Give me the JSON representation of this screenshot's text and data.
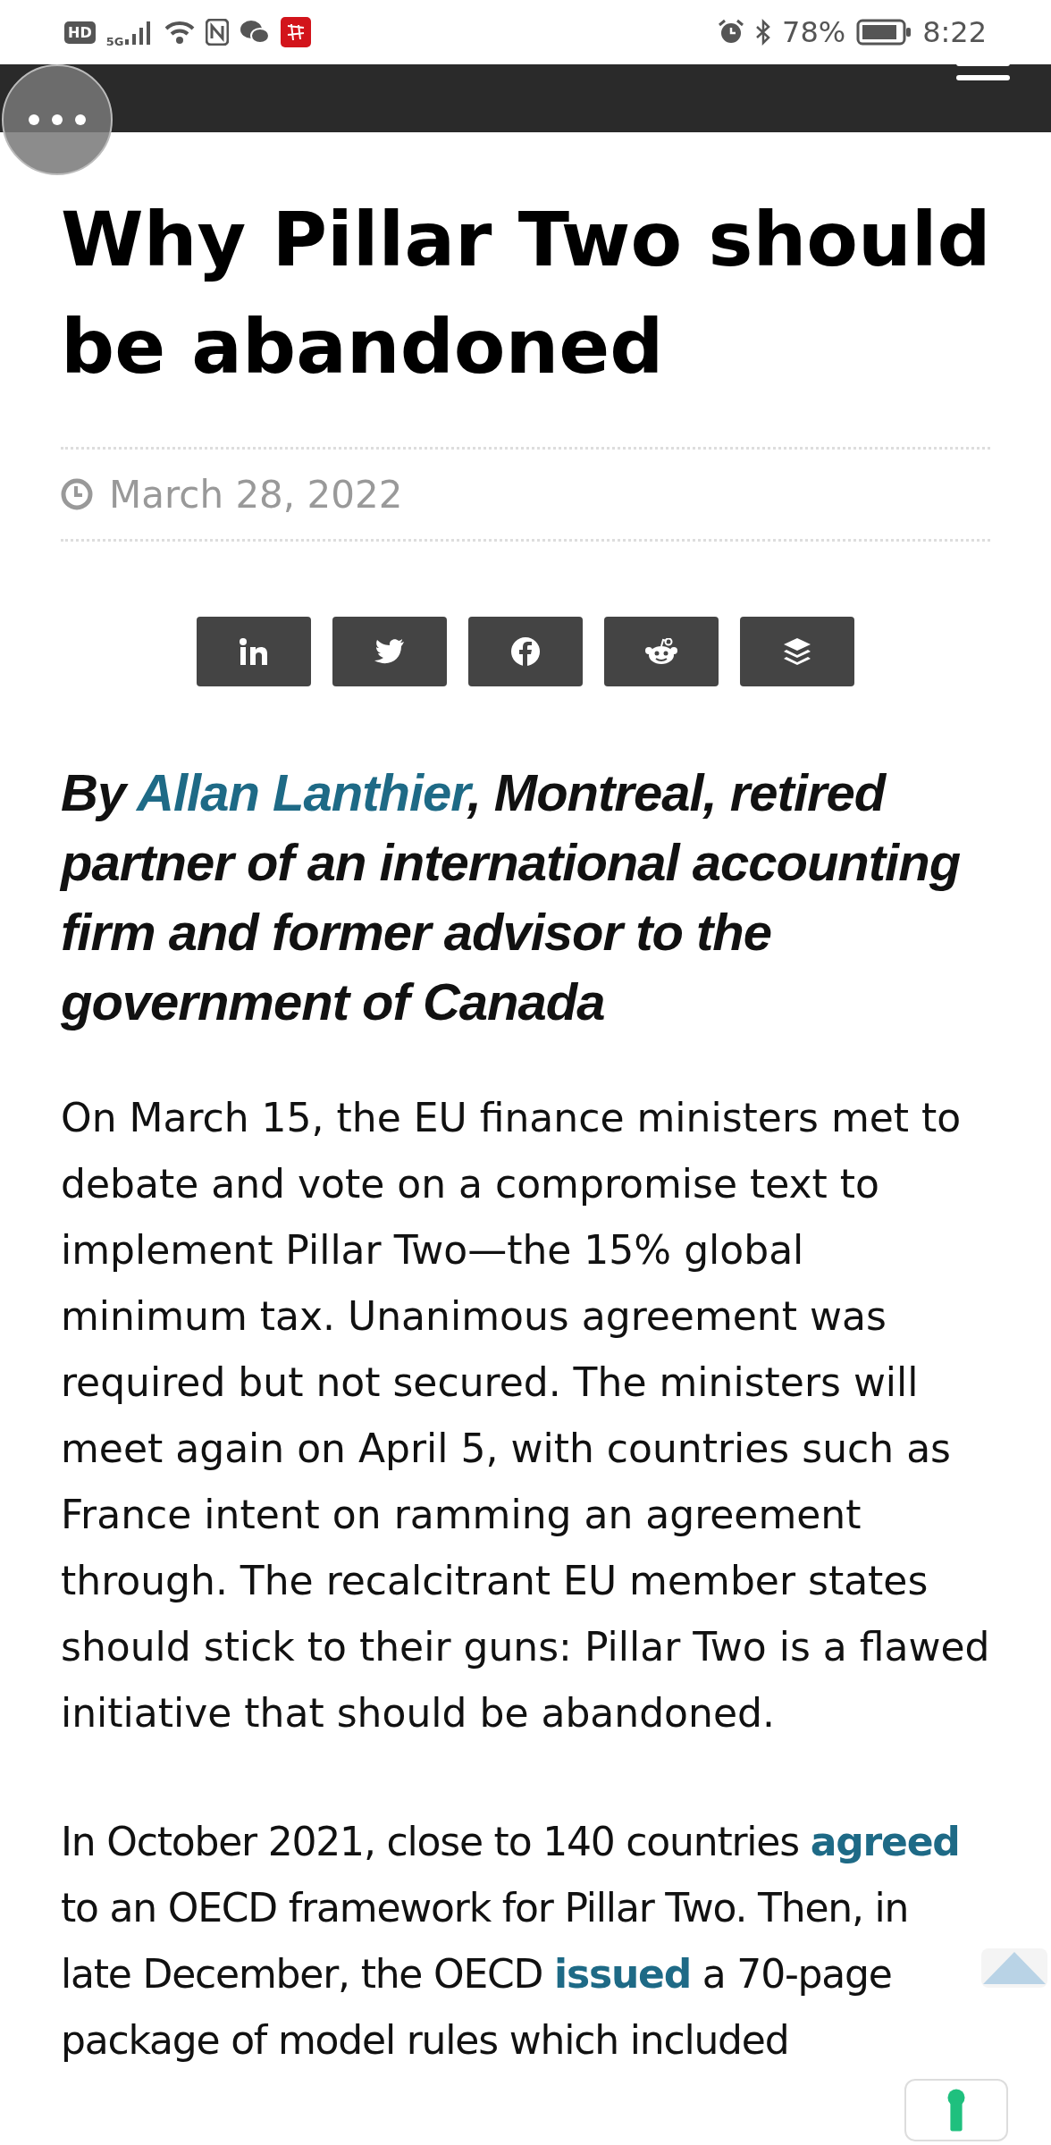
{
  "status_bar": {
    "network_badge": "HD",
    "network_type": "5G",
    "battery": "78%",
    "time": "8:22"
  },
  "article": {
    "title": "Why Pillar Two should be abandoned",
    "date": "March 28, 2022",
    "share_buttons": [
      {
        "kind": "linkedin"
      },
      {
        "kind": "twitter"
      },
      {
        "kind": "facebook"
      },
      {
        "kind": "reddit"
      },
      {
        "kind": "buffer"
      }
    ],
    "byline": [
      {
        "text": "By ",
        "link": false
      },
      {
        "text": "Allan Lanthier",
        "link": true
      },
      {
        "text": ", Montreal, retired partner of an international accounting firm and former advisor to the government of Canada",
        "link": false
      }
    ],
    "paragraphs": [
      [
        {
          "text": "On March 15, the EU finance ministers met to debate and vote on a compromise text to implement Pillar Two—the 15% global minimum tax. Unanimous agreement was required but not secured. The ministers will meet again on April 5, with countries such as France intent on ramming an agreement through. The recalcitrant EU member states should stick to their guns: Pillar Two is a flawed initiative that should be abandoned.",
          "link": false
        }
      ],
      [
        {
          "text": "In October 2021, close to 140 countries ",
          "link": false
        },
        {
          "text": "agreed",
          "link": true
        },
        {
          "text": " to an OECD framework for Pillar Two. Then, in late December, the OECD ",
          "link": false
        },
        {
          "text": "issued",
          "link": true
        },
        {
          "text": " a 70-page package of model rules which included",
          "link": false
        }
      ]
    ]
  }
}
